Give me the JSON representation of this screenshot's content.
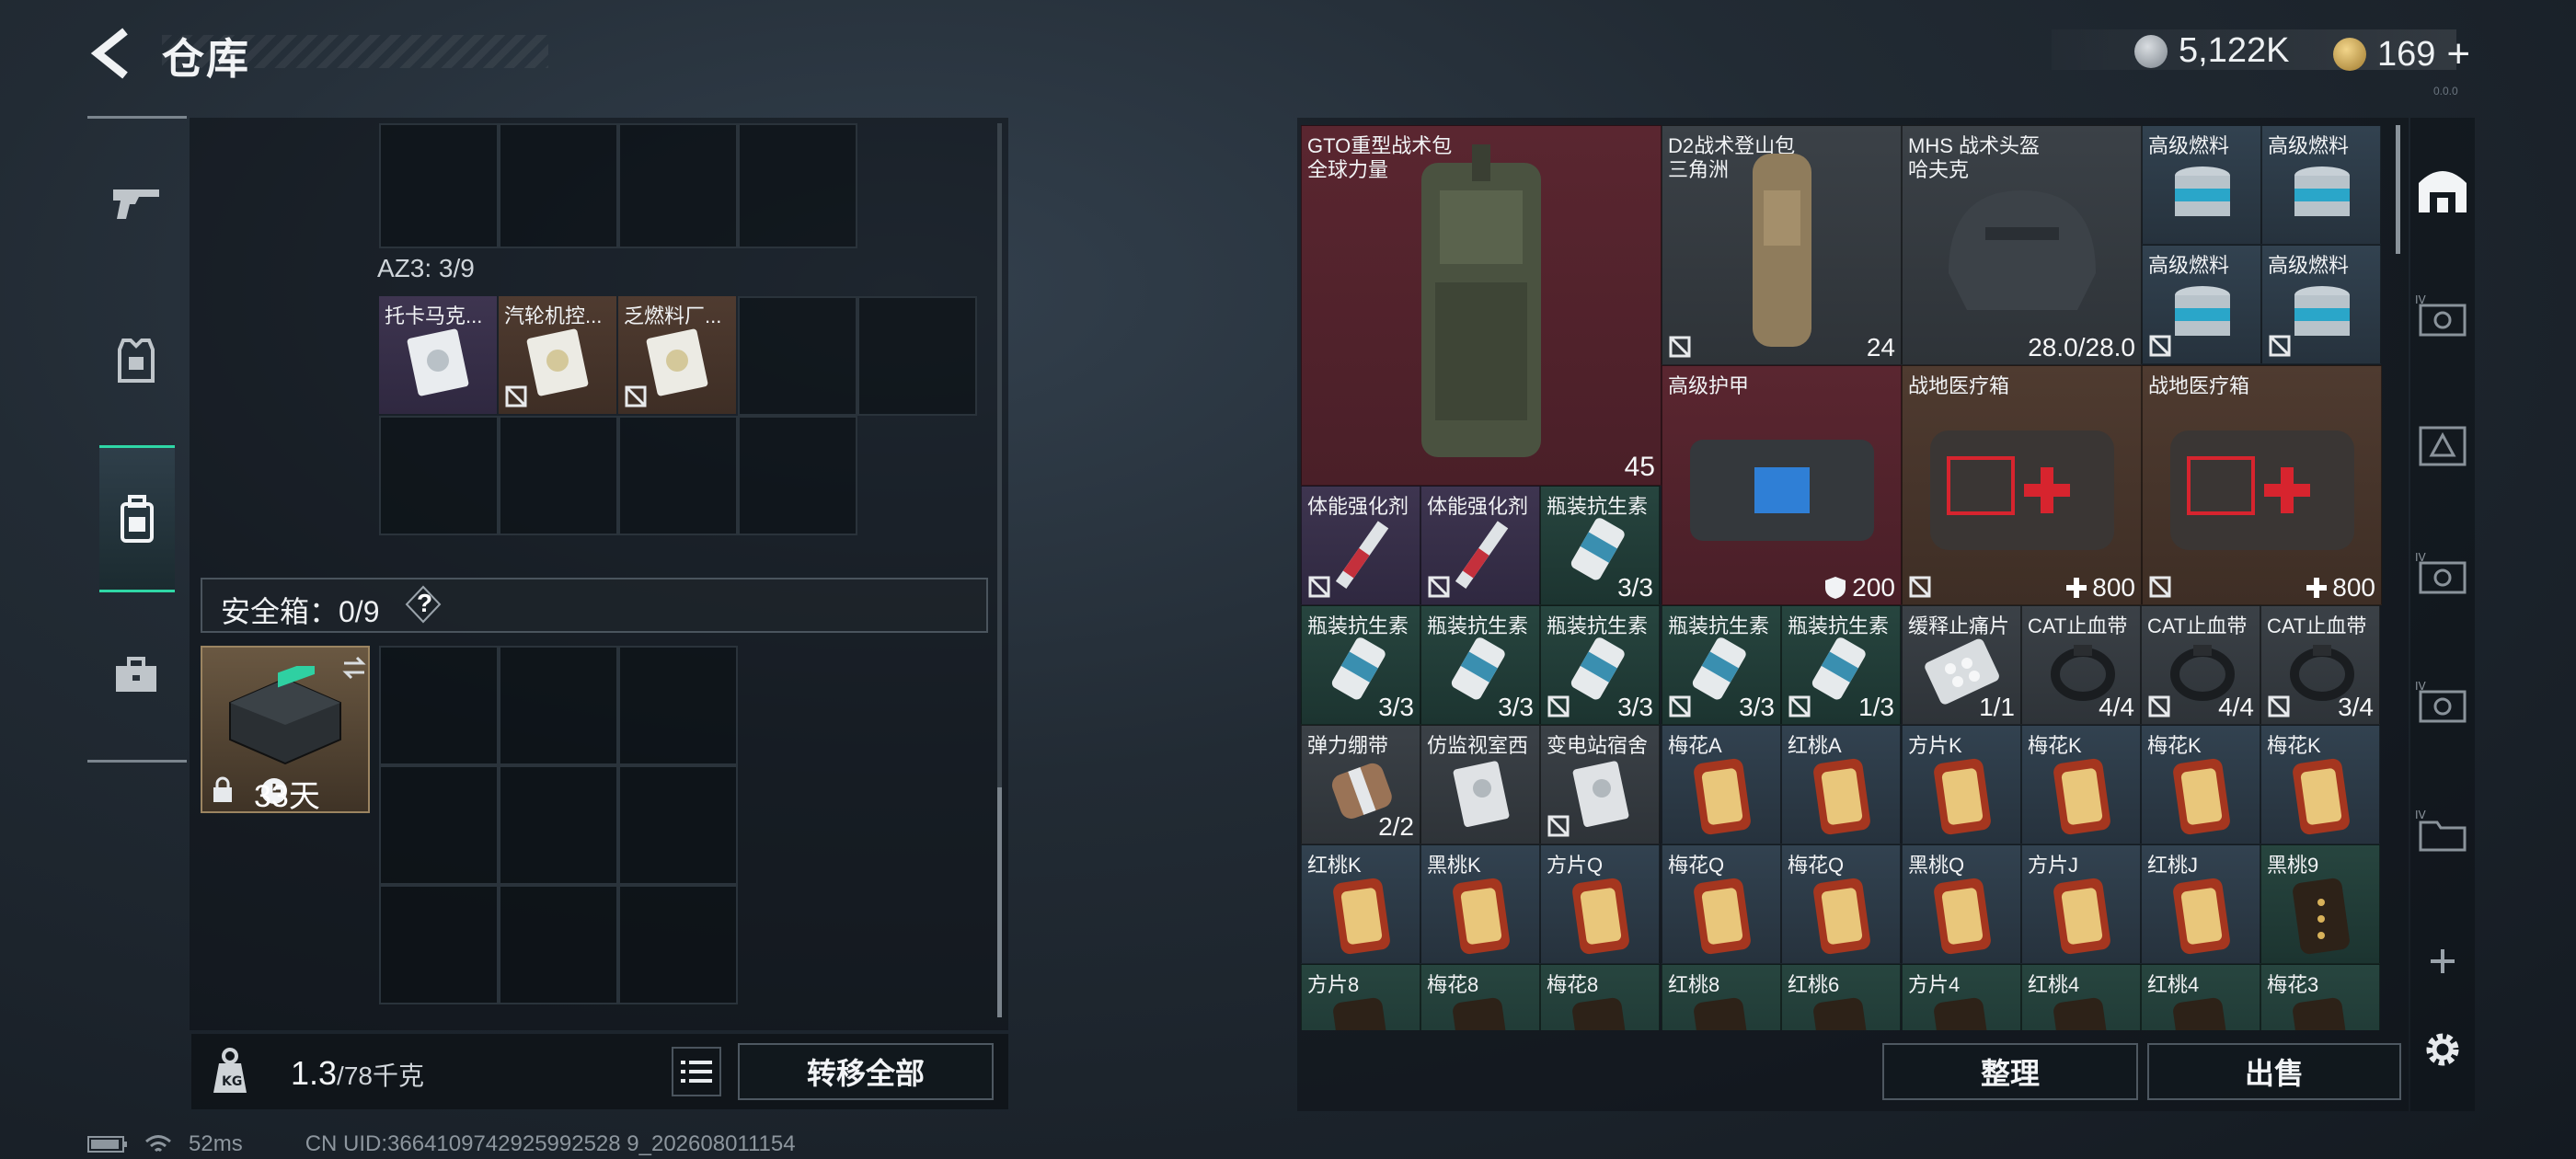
{
  "header": {
    "title": "仓库",
    "currency_silver": "5,122K",
    "currency_gold": "169",
    "plus": "+",
    "version": "0.0.0"
  },
  "left": {
    "az3_label": "AZ3: 3/9",
    "az3_items": [
      {
        "name": "托卡马克...",
        "insured": true
      },
      {
        "name": "汽轮机控...",
        "insured": false
      },
      {
        "name": "乏燃料厂...",
        "insured": false
      }
    ],
    "safe_label": "安全箱：0/9",
    "safe_help": "?",
    "safe_days": "33天",
    "weight_value": "1.3",
    "weight_max": "/78千克",
    "transfer_all": "转移全部"
  },
  "warehouse": {
    "big_items": [
      {
        "name": "GTO重型战术包",
        "sub": "全球力量",
        "count": "45"
      },
      {
        "name": "D2战术登山包",
        "sub": "三角洲",
        "count": "24"
      },
      {
        "name": "MHS 战术头盔",
        "sub": "哈夫克",
        "count": "28.0/28.0"
      },
      {
        "name": "高级护甲",
        "count": "200"
      },
      {
        "name": "战地医疗箱",
        "count": "800"
      },
      {
        "name": "战地医疗箱",
        "count": "800"
      }
    ],
    "fuel": [
      "高级燃料",
      "高级燃料",
      "高级燃料",
      "高级燃料"
    ],
    "row3": [
      {
        "name": "体能强化剂",
        "count": ""
      },
      {
        "name": "体能强化剂",
        "count": ""
      },
      {
        "name": "瓶装抗生素",
        "count": "3/3"
      }
    ],
    "row4": [
      {
        "name": "瓶装抗生素",
        "count": "3/3"
      },
      {
        "name": "瓶装抗生素",
        "count": "3/3"
      },
      {
        "name": "瓶装抗生素",
        "count": "3/3"
      },
      {
        "name": "瓶装抗生素",
        "count": "3/3"
      },
      {
        "name": "瓶装抗生素",
        "count": "1/3"
      },
      {
        "name": "缓释止痛片",
        "count": "1/1"
      },
      {
        "name": "CAT止血带",
        "count": "4/4"
      },
      {
        "name": "CAT止血带",
        "count": "4/4"
      },
      {
        "name": "CAT止血带",
        "count": "3/4"
      }
    ],
    "row5": [
      {
        "name": "弹力绷带",
        "count": "2/2"
      },
      {
        "name": "仿监视室西",
        "count": ""
      },
      {
        "name": "变电站宿舍",
        "count": ""
      },
      {
        "name": "梅花A",
        "count": ""
      },
      {
        "name": "红桃A",
        "count": ""
      },
      {
        "name": "方片K",
        "count": ""
      },
      {
        "name": "梅花K",
        "count": ""
      },
      {
        "name": "梅花K",
        "count": ""
      },
      {
        "name": "梅花K",
        "count": ""
      }
    ],
    "row6": [
      {
        "name": "红桃K"
      },
      {
        "name": "黑桃K"
      },
      {
        "name": "方片Q"
      },
      {
        "name": "梅花Q"
      },
      {
        "name": "梅花Q"
      },
      {
        "name": "黑桃Q"
      },
      {
        "name": "方片J"
      },
      {
        "name": "红桃J"
      },
      {
        "name": "黑桃9"
      }
    ],
    "row7": [
      {
        "name": "方片8"
      },
      {
        "name": "梅花8"
      },
      {
        "name": "梅花8"
      },
      {
        "name": "红桃8"
      },
      {
        "name": "红桃6"
      },
      {
        "name": "方片4"
      },
      {
        "name": "红桃4"
      },
      {
        "name": "红桃4"
      },
      {
        "name": "梅花3"
      }
    ],
    "sort_label": "整理",
    "sell_label": "出售"
  },
  "status": {
    "ping": "52ms",
    "uid": "CN UID:3664109742925992528 9_202608011154"
  },
  "colors": {
    "accent": "#2fd7a6",
    "bg": "#1b222a"
  }
}
